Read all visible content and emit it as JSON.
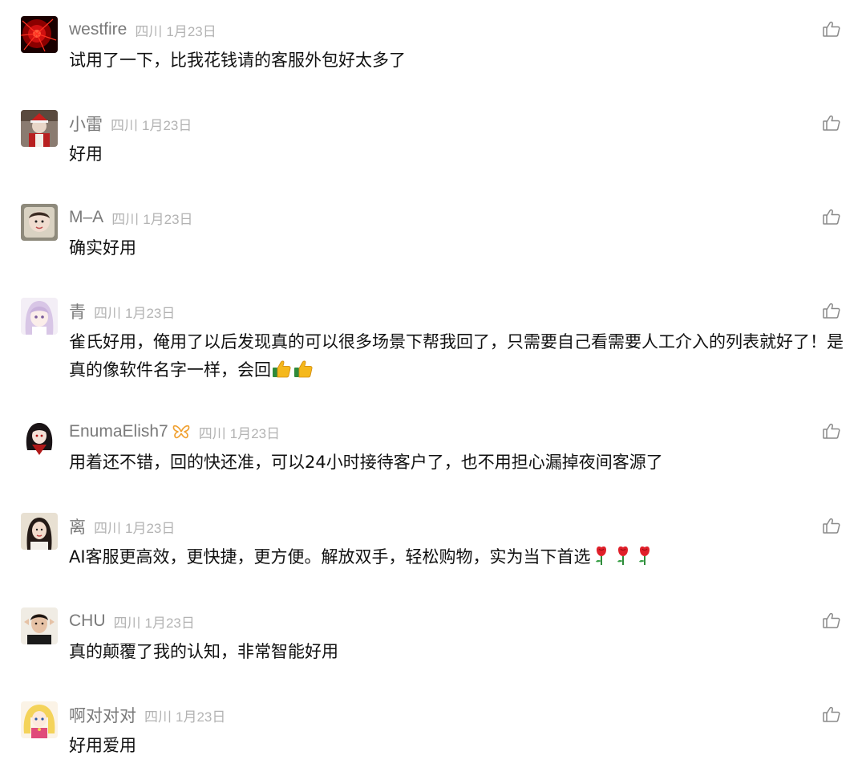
{
  "comments": [
    {
      "name": "westfire",
      "location": "四川",
      "date": "1月23日",
      "text": "试用了一下，比我花钱请的客服外包好太多了",
      "avatar_icon": "red-fireworks-avatar",
      "emojis": []
    },
    {
      "name": "小雷",
      "location": "四川",
      "date": "1月23日",
      "text": "好用",
      "avatar_icon": "christmas-photo-avatar",
      "emojis": []
    },
    {
      "name": "M–A",
      "location": "四川",
      "date": "1月23日",
      "text": "确实好用",
      "avatar_icon": "baby-photo-avatar",
      "emojis": []
    },
    {
      "name": "青",
      "location": "四川",
      "date": "1月23日",
      "text": "雀氏好用，俺用了以后发现真的可以很多场景下帮我回了，只需要自己看需要人工介入的列表就好了！是真的像软件名字一样，会回",
      "avatar_icon": "anime-girl-avatar",
      "emojis": [
        "thumbs-up-icon",
        "thumbs-up-icon"
      ]
    },
    {
      "name": "EnumaElish7",
      "location": "四川",
      "date": "1月23日",
      "text": "用着还不错，回的快还准，可以24小时接待客户了，也不用担心漏掉夜间客源了",
      "avatar_icon": "anime-character-avatar",
      "badge_icon": "butterfly-badge-icon",
      "emojis": []
    },
    {
      "name": "离",
      "location": "四川",
      "date": "1月23日",
      "text": "AI客服更高效，更快捷，更方便。解放双手，轻松购物，实为当下首选",
      "avatar_icon": "woman-photo-avatar",
      "emojis": [
        "rose-icon",
        "rose-icon",
        "rose-icon"
      ]
    },
    {
      "name": "CHU",
      "location": "四川",
      "date": "1月23日",
      "text": "真的颠覆了我的认知，非常智能好用",
      "avatar_icon": "man-photo-avatar",
      "emojis": []
    },
    {
      "name": "啊对对对",
      "location": "四川",
      "date": "1月23日",
      "text": "好用爱用",
      "avatar_icon": "sailor-moon-avatar",
      "emojis": []
    }
  ],
  "colors": {
    "name": "#7a7a7a",
    "meta": "#b3b3b3",
    "text": "#111111",
    "like_icon": "#8a8a8a",
    "badge": "#f0a030"
  }
}
